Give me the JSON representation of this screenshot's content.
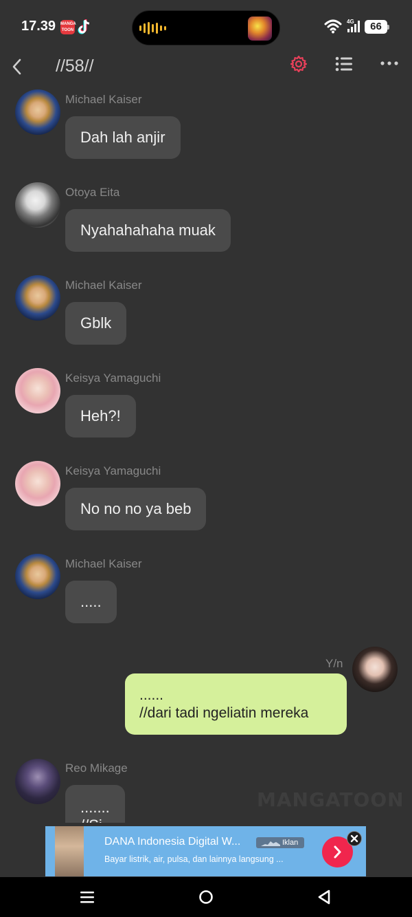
{
  "status_bar": {
    "time": "17.39",
    "app_icon_text": "MANGA TOON",
    "network": "4G",
    "battery": "66"
  },
  "header": {
    "title": "//58//",
    "icons": [
      "back-icon",
      "settings-icon",
      "list-icon",
      "more-icon"
    ],
    "accent_color": "#e8405a"
  },
  "messages": [
    {
      "sender": "Michael Kaiser",
      "text": "Dah lah anjir",
      "side": "left",
      "avatar": "avatar-michael-kaiser"
    },
    {
      "sender": "Otoya Eita",
      "text": "Nyahahahaha muak",
      "side": "left",
      "avatar": "avatar-otoya-eita"
    },
    {
      "sender": "Michael Kaiser",
      "text": "Gblk",
      "side": "left",
      "avatar": "avatar-michael-kaiser"
    },
    {
      "sender": "Keisya Yamaguchi",
      "text": "Heh?!",
      "side": "left",
      "avatar": "avatar-keisya-yamaguchi"
    },
    {
      "sender": "Keisya Yamaguchi",
      "text": "No no no ya beb",
      "side": "left",
      "avatar": "avatar-keisya-yamaguchi"
    },
    {
      "sender": "Michael Kaiser",
      "text": ".....",
      "side": "left",
      "avatar": "avatar-michael-kaiser"
    },
    {
      "sender": "Y/n",
      "lines": [
        "......",
        "//dari tadi ngeliatin mereka"
      ],
      "side": "right",
      "avatar": "avatar-yn"
    },
    {
      "sender": "Reo Mikage",
      "lines": [
        ".......",
        "//Si"
      ],
      "side": "left",
      "avatar": "avatar-reo-mikage"
    }
  ],
  "watermark": "MANGATOON",
  "ad": {
    "title": "DANA Indonesia Digital W...",
    "label": "Iklan",
    "description": "Bayar listrik, air, pulsa, dan lainnya langsung ...",
    "cta_color": "#f0264d",
    "background_color": "#6fb3e8"
  },
  "bubble_colors": {
    "others": "#4a4a4a",
    "me": "#d5f09b"
  },
  "nav_bar": {
    "icons": [
      "menu-icon",
      "home-icon",
      "back-triangle-icon"
    ]
  }
}
